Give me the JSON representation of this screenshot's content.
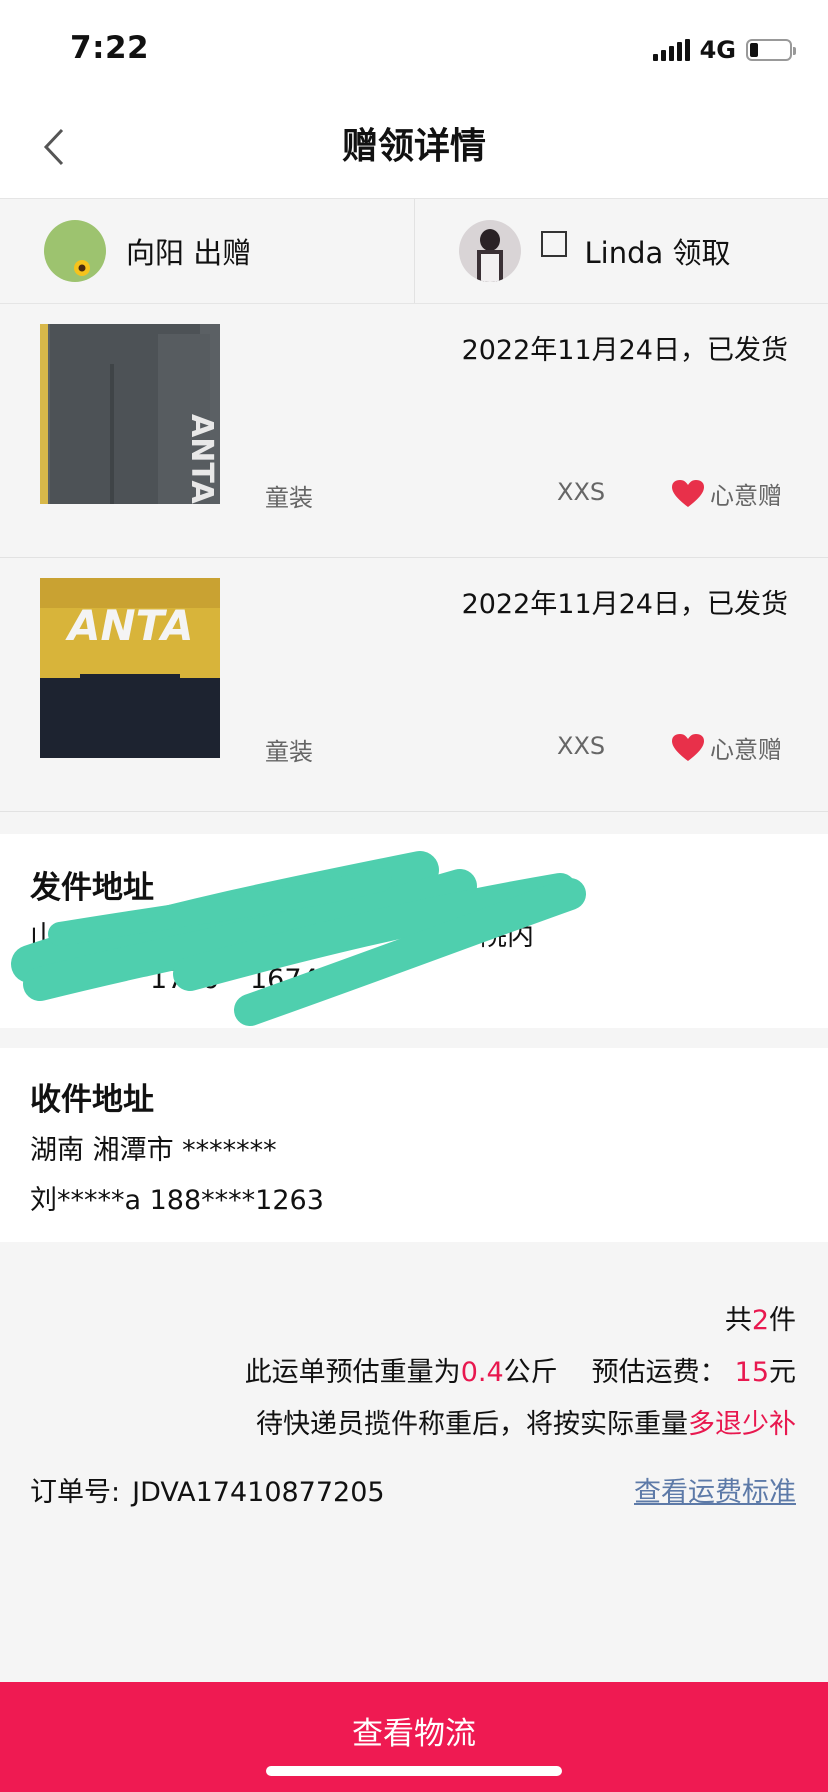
{
  "status_bar": {
    "time": "7:22",
    "network": "4G"
  },
  "nav": {
    "title": "赠领详情"
  },
  "giver": {
    "label": "向阳 出赠"
  },
  "receiver": {
    "label": "Linda 领取"
  },
  "items": [
    {
      "date_status": "2022年11月24日，已发货",
      "category": "童装",
      "size": "XXS",
      "tag": "心意赠"
    },
    {
      "date_status": "2022年11月24日，已发货",
      "category": "童装",
      "size": "XXS",
      "tag": "心意赠"
    }
  ],
  "sender_address": {
    "title": "发件地址",
    "line1_start": "山东 烟台",
    "line1_end": "院内",
    "line2_partial": "1786",
    "line2_partial_end": "1674"
  },
  "receiver_address": {
    "title": "收件地址",
    "line1": "湖南 湘潭市 *******",
    "line2": "刘*****a 188****1263"
  },
  "summary": {
    "count_prefix": "共",
    "count": "2",
    "count_suffix": "件",
    "weight_prefix": "此运单预估重量为",
    "weight": "0.4",
    "weight_unit": "公斤",
    "fee_label": "预估运费：",
    "fee": "15",
    "fee_unit": "元",
    "note_prefix": "待快递员揽件称重后，将按实际重量",
    "note_highlight": "多退少补"
  },
  "order": {
    "label": "订单号:",
    "number": "JDVA17410877205"
  },
  "fee_standard_link": "查看运费标准",
  "bottom_button": "查看物流",
  "colors": {
    "accent": "#ef1a52",
    "highlight": "#e8184f",
    "link": "#5d7aa8",
    "heart": "#e8304a",
    "scribble": "#4fcfae"
  }
}
